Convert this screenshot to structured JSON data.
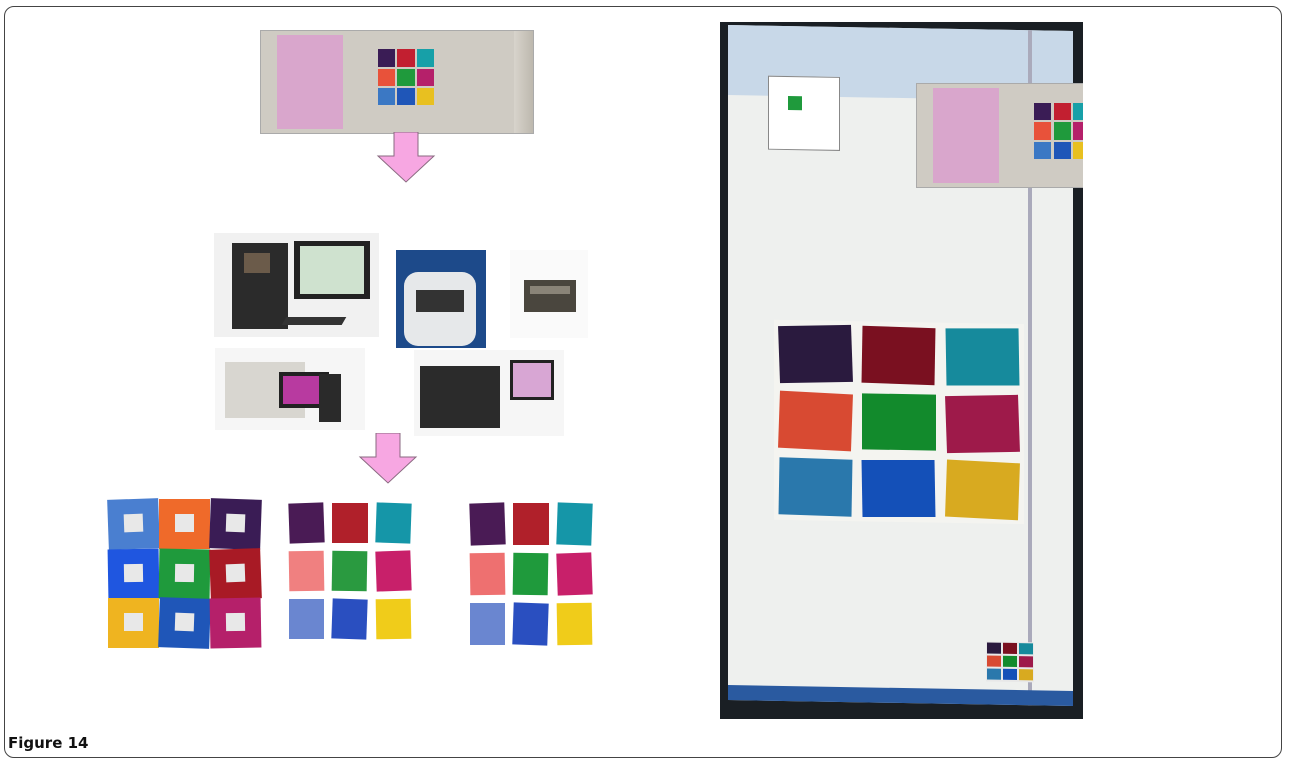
{
  "figure": {
    "caption": "Figure 14"
  },
  "slide": {
    "label_color": "#d9a6cc",
    "patch_colors": [
      "#3a1c55",
      "#c21f30",
      "#17a0a8",
      "#e8523a",
      "#1f9a3c",
      "#b5206a",
      "#3b78c4",
      "#1f56b8",
      "#e8c020"
    ]
  },
  "arrow_color": "#f7a7e2",
  "patch_grids": [
    {
      "colors": [
        "#4a7fd0",
        "#ef6a2a",
        "#3a1c55",
        "#1f56e0",
        "#1f9a3c",
        "#a81a25",
        "#efb420",
        "#1f56b8",
        "#b5206a"
      ],
      "inner_square": true
    },
    {
      "colors": [
        "#4a1b55",
        "#b0202a",
        "#1596a8",
        "#f08080",
        "#2a9a40",
        "#c8206a",
        "#6a86d0",
        "#2a4fc0",
        "#f0cc1a"
      ],
      "inner_square": false
    },
    {
      "colors": [
        "#4a1b55",
        "#b0202a",
        "#1596a8",
        "#ee7070",
        "#1f9a3c",
        "#c8206a",
        "#6a86d0",
        "#2a4fc0",
        "#f0cc1a"
      ],
      "inner_square": false
    }
  ],
  "monitor": {
    "patch_colors": [
      "#2a1a3e",
      "#7a1020",
      "#168a9c",
      "#d84a32",
      "#128a2c",
      "#9e1a4a",
      "#2a78ac",
      "#1450b8",
      "#d8aa20"
    ]
  }
}
